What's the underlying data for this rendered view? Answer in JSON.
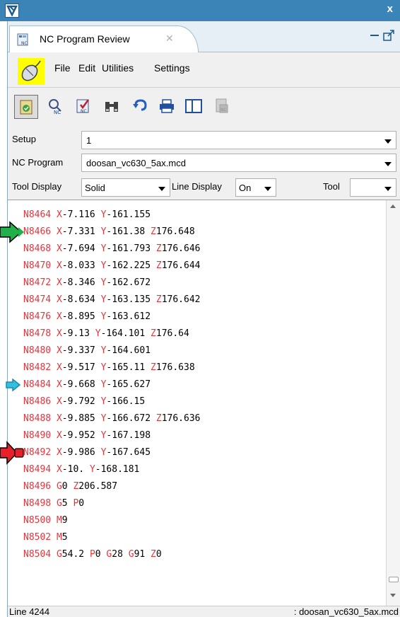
{
  "window": {
    "close_glyph": "x"
  },
  "tab": {
    "title": "NC Program Review",
    "close_glyph": "✕"
  },
  "menu": {
    "items": [
      "File",
      "Edit",
      "Utilities",
      "Settings"
    ]
  },
  "toolbar": {
    "buttons": [
      "verify-icon",
      "zoom-nc-icon",
      "check-nc-icon",
      "binoculars-icon",
      "undo-icon",
      "printer-icon",
      "split-view-icon",
      "nc-disabled-icon"
    ]
  },
  "setup": {
    "label": "Setup",
    "value": "1"
  },
  "nc_program": {
    "label": "NC Program",
    "value": "doosan_vc630_5ax.mcd"
  },
  "display": {
    "tool_display_label": "Tool Display",
    "tool_display_value": "Solid",
    "line_display_label": "Line Display",
    "line_display_value": "On",
    "tool_label": "Tool",
    "tool_value": ""
  },
  "code_lines": [
    [
      [
        "N8464 ",
        "w"
      ],
      [
        "X",
        "w"
      ],
      [
        "-7.116 ",
        "k"
      ],
      [
        "Y",
        "w"
      ],
      [
        "-161.155",
        "k"
      ]
    ],
    [
      [
        "N8466 ",
        "w"
      ],
      [
        "X",
        "w"
      ],
      [
        "-7.331 ",
        "k"
      ],
      [
        "Y",
        "w"
      ],
      [
        "-161.38 ",
        "k"
      ],
      [
        "Z",
        "w"
      ],
      [
        "176.648",
        "k"
      ]
    ],
    [
      [
        "N8468 ",
        "w"
      ],
      [
        "X",
        "w"
      ],
      [
        "-7.694 ",
        "k"
      ],
      [
        "Y",
        "w"
      ],
      [
        "-161.793 ",
        "k"
      ],
      [
        "Z",
        "w"
      ],
      [
        "176.646",
        "k"
      ]
    ],
    [
      [
        "N8470 ",
        "w"
      ],
      [
        "X",
        "w"
      ],
      [
        "-8.033 ",
        "k"
      ],
      [
        "Y",
        "w"
      ],
      [
        "-162.225 ",
        "k"
      ],
      [
        "Z",
        "w"
      ],
      [
        "176.644",
        "k"
      ]
    ],
    [
      [
        "N8472 ",
        "w"
      ],
      [
        "X",
        "w"
      ],
      [
        "-8.346 ",
        "k"
      ],
      [
        "Y",
        "w"
      ],
      [
        "-162.672",
        "k"
      ]
    ],
    [
      [
        "N8474 ",
        "w"
      ],
      [
        "X",
        "w"
      ],
      [
        "-8.634 ",
        "k"
      ],
      [
        "Y",
        "w"
      ],
      [
        "-163.135 ",
        "k"
      ],
      [
        "Z",
        "w"
      ],
      [
        "176.642",
        "k"
      ]
    ],
    [
      [
        "N8476 ",
        "w"
      ],
      [
        "X",
        "w"
      ],
      [
        "-8.895 ",
        "k"
      ],
      [
        "Y",
        "w"
      ],
      [
        "-163.612",
        "k"
      ]
    ],
    [
      [
        "N8478 ",
        "w"
      ],
      [
        "X",
        "w"
      ],
      [
        "-9.13 ",
        "k"
      ],
      [
        "Y",
        "w"
      ],
      [
        "-164.101 ",
        "k"
      ],
      [
        "Z",
        "w"
      ],
      [
        "176.64",
        "k"
      ]
    ],
    [
      [
        "N8480 ",
        "w"
      ],
      [
        "X",
        "w"
      ],
      [
        "-9.337 ",
        "k"
      ],
      [
        "Y",
        "w"
      ],
      [
        "-164.601",
        "k"
      ]
    ],
    [
      [
        "N8482 ",
        "w"
      ],
      [
        "X",
        "w"
      ],
      [
        "-9.517 ",
        "k"
      ],
      [
        "Y",
        "w"
      ],
      [
        "-165.11 ",
        "k"
      ],
      [
        "Z",
        "w"
      ],
      [
        "176.638",
        "k"
      ]
    ],
    [
      [
        "N8484 ",
        "w"
      ],
      [
        "X",
        "w"
      ],
      [
        "-9.668 ",
        "k"
      ],
      [
        "Y",
        "w"
      ],
      [
        "-165.627",
        "k"
      ]
    ],
    [
      [
        "N8486 ",
        "w"
      ],
      [
        "X",
        "w"
      ],
      [
        "-9.792 ",
        "k"
      ],
      [
        "Y",
        "w"
      ],
      [
        "-166.15",
        "k"
      ]
    ],
    [
      [
        "N8488 ",
        "w"
      ],
      [
        "X",
        "w"
      ],
      [
        "-9.885 ",
        "k"
      ],
      [
        "Y",
        "w"
      ],
      [
        "-166.672 ",
        "k"
      ],
      [
        "Z",
        "w"
      ],
      [
        "176.636",
        "k"
      ]
    ],
    [
      [
        "N8490 ",
        "w"
      ],
      [
        "X",
        "w"
      ],
      [
        "-9.952 ",
        "k"
      ],
      [
        "Y",
        "w"
      ],
      [
        "-167.198",
        "k"
      ]
    ],
    [
      [
        "N8492 ",
        "w"
      ],
      [
        "X",
        "w"
      ],
      [
        "-9.986 ",
        "k"
      ],
      [
        "Y",
        "w"
      ],
      [
        "-167.645",
        "k"
      ]
    ],
    [
      [
        "N8494 ",
        "w"
      ],
      [
        "X",
        "w"
      ],
      [
        "-10. ",
        "k"
      ],
      [
        "Y",
        "w"
      ],
      [
        "-168.181",
        "k"
      ]
    ],
    [
      [
        "N8496 ",
        "w"
      ],
      [
        "G",
        "w"
      ],
      [
        "0 ",
        "k"
      ],
      [
        "Z",
        "w"
      ],
      [
        "206.587",
        "k"
      ]
    ],
    [
      [
        "N8498 ",
        "w"
      ],
      [
        "G",
        "w"
      ],
      [
        "5 ",
        "k"
      ],
      [
        "P",
        "w"
      ],
      [
        "0",
        "k"
      ]
    ],
    [
      [
        "N8500 ",
        "w"
      ],
      [
        "M",
        "w"
      ],
      [
        "9",
        "k"
      ]
    ],
    [
      [
        "N8502 ",
        "w"
      ],
      [
        "M",
        "w"
      ],
      [
        "5",
        "k"
      ]
    ],
    [
      [
        "N8504 ",
        "w"
      ],
      [
        "G",
        "w"
      ],
      [
        "54.2 ",
        "k"
      ],
      [
        "P",
        "w"
      ],
      [
        "0 ",
        "k"
      ],
      [
        "G",
        "w"
      ],
      [
        "28 ",
        "k"
      ],
      [
        "G",
        "w"
      ],
      [
        "91 ",
        "k"
      ],
      [
        "Z",
        "w"
      ],
      [
        "0",
        "k"
      ]
    ]
  ],
  "markers": {
    "current": {
      "line": 1,
      "color": "#22b04a",
      "icon": "green-arrow-icon"
    },
    "pointer": {
      "line": 10,
      "color": "#33c0e0",
      "icon": "cyan-arrow-icon"
    },
    "stop": {
      "line": 14,
      "color": "#e8202a",
      "icon": "red-stop-icon"
    }
  },
  "status": {
    "left": "Line 4244",
    "right": ": doosan_vc630_5ax.mcd"
  },
  "colors": {
    "title_bar": "#3a84b8",
    "code_word": "#e8343c",
    "highlight": "#ffff00"
  }
}
